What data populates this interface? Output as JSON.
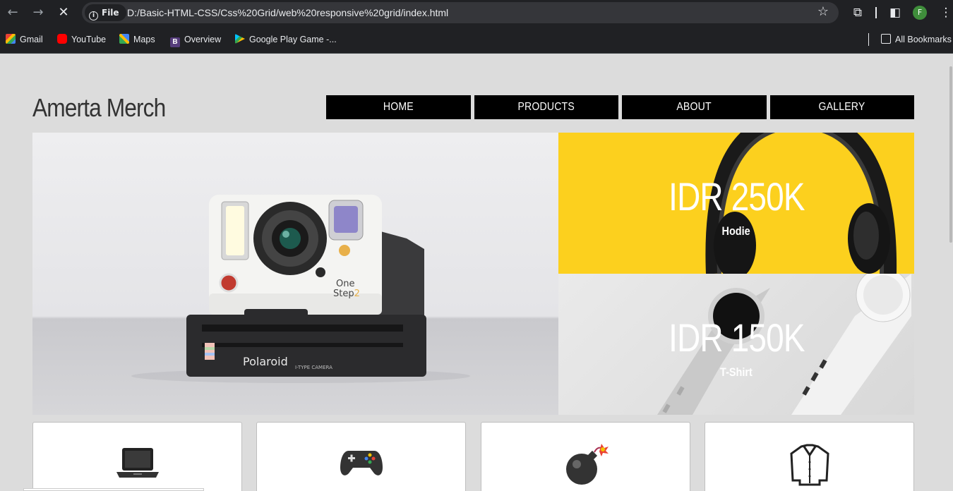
{
  "browser": {
    "url": "D:/Basic-HTML-CSS/Css%20Grid/web%20responsive%20grid/index.html",
    "scheme_chip": "File",
    "profile_initial": "F",
    "bookmarks": [
      {
        "label": "Gmail",
        "icon": "gmail-icon",
        "color": "#ea4335"
      },
      {
        "label": "YouTube",
        "icon": "youtube-icon",
        "color": "#ff0000"
      },
      {
        "label": "Maps",
        "icon": "maps-icon",
        "color": "#34a853"
      },
      {
        "label": "Overview",
        "icon": "bootstrap-icon",
        "color": "#563d7c"
      },
      {
        "label": "Google Play Game -...",
        "icon": "google-play-icon",
        "color": "#00c3ff"
      }
    ],
    "all_bookmarks": "All Bookmarks"
  },
  "site": {
    "brand": "Amerta Merch",
    "menu": [
      "HOME",
      "PRODUCTS",
      "ABOUT",
      "GALLERY"
    ],
    "hero": {
      "brand_text": "Polaroid",
      "model_text": "One Step 2",
      "sub_text": "I-TYPE CAMERA"
    },
    "promos": [
      {
        "price": "IDR 250K",
        "name": "Hodie",
        "bg": "#fcd01e"
      },
      {
        "price": "IDR 150K",
        "name": "T-Shirt",
        "bg": "#dedede"
      }
    ],
    "cards": [
      {
        "icon": "laptop-icon"
      },
      {
        "icon": "game-controller-icon"
      },
      {
        "icon": "bomb-icon"
      },
      {
        "icon": "shirt-icon"
      }
    ]
  }
}
